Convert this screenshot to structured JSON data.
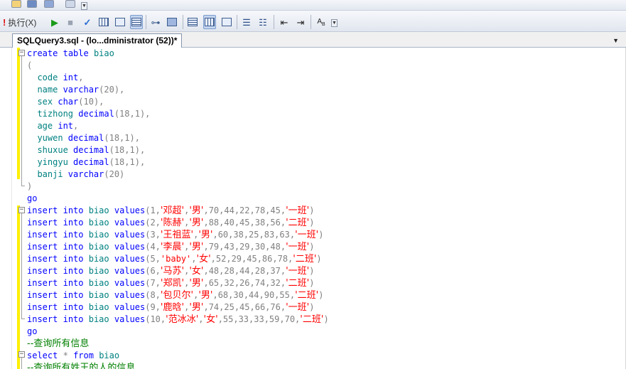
{
  "toolbar": {
    "execute_label": "执行(X)"
  },
  "tab": {
    "title": "SQLQuery3.sql - (lo...dministrator (52))*"
  },
  "editor": {
    "lines": [
      [
        {
          "t": "create",
          "c": "kw"
        },
        {
          "t": " "
        },
        {
          "t": "table",
          "c": "kw"
        },
        {
          "t": " "
        },
        {
          "t": "biao",
          "c": "id"
        }
      ],
      [
        {
          "t": "(",
          "c": "gr"
        }
      ],
      [
        {
          "t": "  code ",
          "c": "id"
        },
        {
          "t": "int",
          "c": "ty"
        },
        {
          "t": ",",
          "c": "gr"
        }
      ],
      [
        {
          "t": "  name ",
          "c": "id"
        },
        {
          "t": "varchar",
          "c": "ty"
        },
        {
          "t": "(20),",
          "c": "gr"
        }
      ],
      [
        {
          "t": "  sex ",
          "c": "id"
        },
        {
          "t": "char",
          "c": "ty"
        },
        {
          "t": "(10),",
          "c": "gr"
        }
      ],
      [
        {
          "t": "  tizhong ",
          "c": "id"
        },
        {
          "t": "decimal",
          "c": "ty"
        },
        {
          "t": "(18,1),",
          "c": "gr"
        }
      ],
      [
        {
          "t": "  age ",
          "c": "id"
        },
        {
          "t": "int",
          "c": "ty"
        },
        {
          "t": ",",
          "c": "gr"
        }
      ],
      [
        {
          "t": "  yuwen ",
          "c": "id"
        },
        {
          "t": "decimal",
          "c": "ty"
        },
        {
          "t": "(18,1),",
          "c": "gr"
        }
      ],
      [
        {
          "t": "  shuxue ",
          "c": "id"
        },
        {
          "t": "decimal",
          "c": "ty"
        },
        {
          "t": "(18,1),",
          "c": "gr"
        }
      ],
      [
        {
          "t": "  yingyu ",
          "c": "id"
        },
        {
          "t": "decimal",
          "c": "ty"
        },
        {
          "t": "(18,1),",
          "c": "gr"
        }
      ],
      [
        {
          "t": "  banji ",
          "c": "id"
        },
        {
          "t": "varchar",
          "c": "ty"
        },
        {
          "t": "(20)",
          "c": "gr"
        }
      ],
      [
        {
          "t": ")",
          "c": "gr"
        }
      ],
      [
        {
          "t": "go",
          "c": "kw"
        }
      ],
      [
        {
          "t": "insert",
          "c": "kw"
        },
        {
          "t": " "
        },
        {
          "t": "into",
          "c": "kw"
        },
        {
          "t": " "
        },
        {
          "t": "biao",
          "c": "id"
        },
        {
          "t": " "
        },
        {
          "t": "values",
          "c": "kw"
        },
        {
          "t": "(1,",
          "c": "gr"
        },
        {
          "t": "'邓超'",
          "c": "st"
        },
        {
          "t": ",",
          "c": "gr"
        },
        {
          "t": "'男'",
          "c": "st"
        },
        {
          "t": ",70,44,22,78,45,",
          "c": "gr"
        },
        {
          "t": "'一班'",
          "c": "st"
        },
        {
          "t": ")",
          "c": "gr"
        }
      ],
      [
        {
          "t": "insert",
          "c": "kw"
        },
        {
          "t": " "
        },
        {
          "t": "into",
          "c": "kw"
        },
        {
          "t": " "
        },
        {
          "t": "biao",
          "c": "id"
        },
        {
          "t": " "
        },
        {
          "t": "values",
          "c": "kw"
        },
        {
          "t": "(2,",
          "c": "gr"
        },
        {
          "t": "'陈赫'",
          "c": "st"
        },
        {
          "t": ",",
          "c": "gr"
        },
        {
          "t": "'男'",
          "c": "st"
        },
        {
          "t": ",88,40,45,38,56,",
          "c": "gr"
        },
        {
          "t": "'二班'",
          "c": "st"
        },
        {
          "t": ")",
          "c": "gr"
        }
      ],
      [
        {
          "t": "insert",
          "c": "kw"
        },
        {
          "t": " "
        },
        {
          "t": "into",
          "c": "kw"
        },
        {
          "t": " "
        },
        {
          "t": "biao",
          "c": "id"
        },
        {
          "t": " "
        },
        {
          "t": "values",
          "c": "kw"
        },
        {
          "t": "(3,",
          "c": "gr"
        },
        {
          "t": "'王祖蓝'",
          "c": "st"
        },
        {
          "t": ",",
          "c": "gr"
        },
        {
          "t": "'男'",
          "c": "st"
        },
        {
          "t": ",60,38,25,83,63,",
          "c": "gr"
        },
        {
          "t": "'一班'",
          "c": "st"
        },
        {
          "t": ")",
          "c": "gr"
        }
      ],
      [
        {
          "t": "insert",
          "c": "kw"
        },
        {
          "t": " "
        },
        {
          "t": "into",
          "c": "kw"
        },
        {
          "t": " "
        },
        {
          "t": "biao",
          "c": "id"
        },
        {
          "t": " "
        },
        {
          "t": "values",
          "c": "kw"
        },
        {
          "t": "(4,",
          "c": "gr"
        },
        {
          "t": "'李晨'",
          "c": "st"
        },
        {
          "t": ",",
          "c": "gr"
        },
        {
          "t": "'男'",
          "c": "st"
        },
        {
          "t": ",79,43,29,30,48,",
          "c": "gr"
        },
        {
          "t": "'一班'",
          "c": "st"
        },
        {
          "t": ")",
          "c": "gr"
        }
      ],
      [
        {
          "t": "insert",
          "c": "kw"
        },
        {
          "t": " "
        },
        {
          "t": "into",
          "c": "kw"
        },
        {
          "t": " "
        },
        {
          "t": "biao",
          "c": "id"
        },
        {
          "t": " "
        },
        {
          "t": "values",
          "c": "kw"
        },
        {
          "t": "(5,",
          "c": "gr"
        },
        {
          "t": "'baby'",
          "c": "st"
        },
        {
          "t": ",",
          "c": "gr"
        },
        {
          "t": "'女'",
          "c": "st"
        },
        {
          "t": ",52,29,45,86,78,",
          "c": "gr"
        },
        {
          "t": "'二班'",
          "c": "st"
        },
        {
          "t": ")",
          "c": "gr"
        }
      ],
      [
        {
          "t": "insert",
          "c": "kw"
        },
        {
          "t": " "
        },
        {
          "t": "into",
          "c": "kw"
        },
        {
          "t": " "
        },
        {
          "t": "biao",
          "c": "id"
        },
        {
          "t": " "
        },
        {
          "t": "values",
          "c": "kw"
        },
        {
          "t": "(6,",
          "c": "gr"
        },
        {
          "t": "'马苏'",
          "c": "st"
        },
        {
          "t": ",",
          "c": "gr"
        },
        {
          "t": "'女'",
          "c": "st"
        },
        {
          "t": ",48,28,44,28,37,",
          "c": "gr"
        },
        {
          "t": "'一班'",
          "c": "st"
        },
        {
          "t": ")",
          "c": "gr"
        }
      ],
      [
        {
          "t": "insert",
          "c": "kw"
        },
        {
          "t": " "
        },
        {
          "t": "into",
          "c": "kw"
        },
        {
          "t": " "
        },
        {
          "t": "biao",
          "c": "id"
        },
        {
          "t": " "
        },
        {
          "t": "values",
          "c": "kw"
        },
        {
          "t": "(7,",
          "c": "gr"
        },
        {
          "t": "'郑凯'",
          "c": "st"
        },
        {
          "t": ",",
          "c": "gr"
        },
        {
          "t": "'男'",
          "c": "st"
        },
        {
          "t": ",65,32,26,74,32,",
          "c": "gr"
        },
        {
          "t": "'二班'",
          "c": "st"
        },
        {
          "t": ")",
          "c": "gr"
        }
      ],
      [
        {
          "t": "insert",
          "c": "kw"
        },
        {
          "t": " "
        },
        {
          "t": "into",
          "c": "kw"
        },
        {
          "t": " "
        },
        {
          "t": "biao",
          "c": "id"
        },
        {
          "t": " "
        },
        {
          "t": "values",
          "c": "kw"
        },
        {
          "t": "(8,",
          "c": "gr"
        },
        {
          "t": "'包贝尔'",
          "c": "st"
        },
        {
          "t": ",",
          "c": "gr"
        },
        {
          "t": "'男'",
          "c": "st"
        },
        {
          "t": ",68,30,44,90,55,",
          "c": "gr"
        },
        {
          "t": "'二班'",
          "c": "st"
        },
        {
          "t": ")",
          "c": "gr"
        }
      ],
      [
        {
          "t": "insert",
          "c": "kw"
        },
        {
          "t": " "
        },
        {
          "t": "into",
          "c": "kw"
        },
        {
          "t": " "
        },
        {
          "t": "biao",
          "c": "id"
        },
        {
          "t": " "
        },
        {
          "t": "values",
          "c": "kw"
        },
        {
          "t": "(9,",
          "c": "gr"
        },
        {
          "t": "'鹿晗'",
          "c": "st"
        },
        {
          "t": ",",
          "c": "gr"
        },
        {
          "t": "'男'",
          "c": "st"
        },
        {
          "t": ",74,25,45,66,76,",
          "c": "gr"
        },
        {
          "t": "'一班'",
          "c": "st"
        },
        {
          "t": ")",
          "c": "gr"
        }
      ],
      [
        {
          "t": "insert",
          "c": "kw"
        },
        {
          "t": " "
        },
        {
          "t": "into",
          "c": "kw"
        },
        {
          "t": " "
        },
        {
          "t": "biao",
          "c": "id"
        },
        {
          "t": " "
        },
        {
          "t": "values",
          "c": "kw"
        },
        {
          "t": "(10,",
          "c": "gr"
        },
        {
          "t": "'范冰冰'",
          "c": "st"
        },
        {
          "t": ",",
          "c": "gr"
        },
        {
          "t": "'女'",
          "c": "st"
        },
        {
          "t": ",55,33,33,59,70,",
          "c": "gr"
        },
        {
          "t": "'二班'",
          "c": "st"
        },
        {
          "t": ")",
          "c": "gr"
        }
      ],
      [
        {
          "t": "go",
          "c": "kw"
        }
      ],
      [
        {
          "t": "--查询所有信息",
          "c": "cm"
        }
      ],
      [
        {
          "t": "select",
          "c": "kw"
        },
        {
          "t": " "
        },
        {
          "t": "*",
          "c": "gr"
        },
        {
          "t": " "
        },
        {
          "t": "from",
          "c": "kw"
        },
        {
          "t": " "
        },
        {
          "t": "biao",
          "c": "id"
        }
      ],
      [
        {
          "t": "--查询所有姓王的人的信息",
          "c": "cm"
        }
      ]
    ]
  },
  "colors": {
    "keyword": "#0000ff",
    "identifier": "#008080",
    "punct": "#808080",
    "string": "#ff0000",
    "comment": "#008000",
    "change_bar": "#ffef00"
  }
}
